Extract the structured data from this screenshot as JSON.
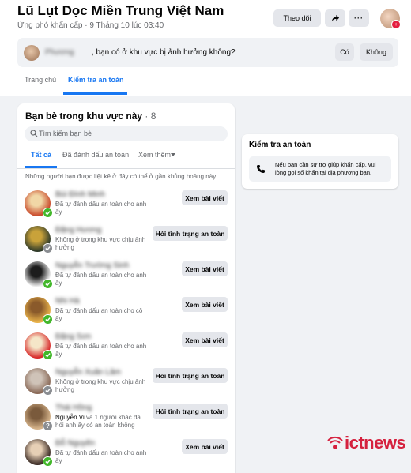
{
  "header": {
    "title": "Lũ Lụt Dọc Miền Trung Việt Nam",
    "subtitle": "Ứng phó khẩn cấp · 9 Tháng 10 lúc 03:40",
    "follow_label": "Theo dõi",
    "more_label": "···",
    "share_icon": "share-icon",
    "avatar_badge": "+"
  },
  "question": {
    "blurred_name": "Phương",
    "text": ", bạn có ở khu vực bị ảnh hưởng không?",
    "yes_label": "Có",
    "no_label": "Không"
  },
  "tabs": [
    {
      "label": "Trang chủ",
      "active": false
    },
    {
      "label": "Kiểm tra an toàn",
      "active": true
    }
  ],
  "friends_panel": {
    "title": "Bạn bè trong khu vực này",
    "count": "· 8",
    "search_placeholder": "Tìm kiếm bạn bè",
    "filter_tabs": [
      "Tất cả",
      "Đã đánh dấu an toàn",
      "Xem thêm"
    ],
    "note": "Những người bạn được liệt kê ở đây có thể ở gần khủng hoảng này.",
    "friends": [
      {
        "name": "Bùi Đình Minh",
        "status": "Đã tự đánh dấu an toàn cho anh ấy",
        "button": "Xem bài viết",
        "safe": true,
        "colors": [
          "#c94b2c",
          "#f1d7a6"
        ]
      },
      {
        "name": "Đặng Hương",
        "status": "Không ở trong khu vực chịu ảnh hưởng",
        "button": "Hỏi tình trạng an toàn",
        "safe": false,
        "colors": [
          "#2e3a2a",
          "#c9a23a"
        ]
      },
      {
        "name": "Nguyễn Trường Sinh",
        "status": "Đã tự đánh dấu an toàn cho anh ấy",
        "button": "Xem bài viết",
        "safe": true,
        "colors": [
          "#f3f3f3",
          "#1d1d1d"
        ]
      },
      {
        "name": "Nhi Hà",
        "status": "Đã tự đánh dấu an toàn cho cô ấy",
        "button": "Xem bài viết",
        "safe": true,
        "colors": [
          "#e8b24a",
          "#8a5a2b"
        ]
      },
      {
        "name": "Đặng Sơn",
        "status": "Đã tự đánh dấu an toàn cho anh ấy",
        "button": "Xem bài viết",
        "safe": true,
        "colors": [
          "#d82a2a",
          "#f5e6c8"
        ]
      },
      {
        "name": "Nguyễn Xuân Lâm",
        "status": "Không ở trong khu vực chịu ảnh hưởng",
        "button": "Hỏi tình trạng an toàn",
        "safe": false,
        "colors": [
          "#8a6a58",
          "#cfc3b8"
        ]
      },
      {
        "name": "Thái Hồng",
        "status_name": "Nguyễn Vi",
        "status": " và 1 người khác đã hỏi anh ấy có an toàn không",
        "button": "Hỏi tình trạng an toàn",
        "safe": false,
        "question": true,
        "colors": [
          "#d6b48b",
          "#7a5a3c"
        ]
      },
      {
        "name": "Đỗ Nguyên",
        "status": "Đã tự đánh dấu an toàn cho anh ấy",
        "button": "Xem bài viết",
        "safe": true,
        "colors": [
          "#3a2a24",
          "#e6cfb5"
        ]
      }
    ]
  },
  "safety_panel": {
    "title": "Kiểm tra an toàn",
    "text": "Nếu bạn cần sự trợ giúp khẩn cấp, vui lòng gọi số khẩn tại địa phương bạn."
  },
  "logo": {
    "text": "ictnews"
  },
  "colors": {
    "accent": "#1877f2",
    "safe": "#42b72a",
    "gray": "#65676b",
    "brand": "#d5213e"
  }
}
